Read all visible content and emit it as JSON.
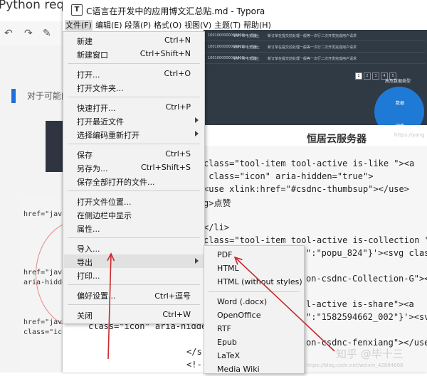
{
  "background": {
    "top_text": "Python requests + tkcsDNkif | 操作bar",
    "cut_text": "对于可能的",
    "code_lines": [
      "href=\"javas",
      "href=\"javas",
      "aria-hidde",
      "href=\"javas",
      "class=\"icon"
    ]
  },
  "window": {
    "app_icon": "T",
    "title": "C语言在开发中的应用博文汇总贴.md - Typora"
  },
  "menubar": [
    {
      "label": "文件(F)",
      "active": true
    },
    {
      "label": "编辑(E)",
      "active": false
    },
    {
      "label": "段落(P)",
      "active": false
    },
    {
      "label": "格式(O)",
      "active": false
    },
    {
      "label": "视图(V)",
      "active": false
    },
    {
      "label": "主题(T)",
      "active": false
    },
    {
      "label": "帮助(H)",
      "active": false
    }
  ],
  "file_menu": {
    "items": [
      {
        "label": "新建",
        "shortcut": "Ctrl+N"
      },
      {
        "label": "新建窗口",
        "shortcut": "Ctrl+Shift+N"
      },
      {
        "separator": true
      },
      {
        "label": "打开...",
        "shortcut": "Ctrl+O"
      },
      {
        "label": "打开文件夹...",
        "shortcut": ""
      },
      {
        "separator": true
      },
      {
        "label": "快速打开...",
        "shortcut": "Ctrl+P"
      },
      {
        "label": "打开最近文件",
        "shortcut": "",
        "submenu": true
      },
      {
        "label": "选择编码重新打开",
        "shortcut": "",
        "submenu": true
      },
      {
        "separator": true
      },
      {
        "label": "保存",
        "shortcut": "Ctrl+S"
      },
      {
        "label": "另存为...",
        "shortcut": "Ctrl+Shift+S"
      },
      {
        "label": "保存全部打开的文件...",
        "shortcut": ""
      },
      {
        "separator": true
      },
      {
        "label": "打开文件位置...",
        "shortcut": ""
      },
      {
        "label": "在侧边栏中显示",
        "shortcut": ""
      },
      {
        "label": "属性...",
        "shortcut": ""
      },
      {
        "separator": true
      },
      {
        "label": "导入...",
        "shortcut": ""
      },
      {
        "label": "导出",
        "shortcut": "",
        "submenu": true,
        "highlighted": true
      },
      {
        "label": "打印...",
        "shortcut": ""
      },
      {
        "separator": true
      },
      {
        "label": "偏好设置...",
        "shortcut": "Ctrl+逗号"
      },
      {
        "separator": true
      },
      {
        "label": "关闭",
        "shortcut": "Ctrl+W"
      }
    ]
  },
  "export_menu": {
    "items": [
      {
        "label": "PDF"
      },
      {
        "label": "HTML"
      },
      {
        "label": "HTML (without styles)"
      },
      {
        "separator": true
      },
      {
        "label": "Word (.docx)"
      },
      {
        "label": "OpenOffice"
      },
      {
        "label": "RTF"
      },
      {
        "label": "Epub"
      },
      {
        "label": "LaTeX"
      },
      {
        "label": "Media Wiki"
      }
    ]
  },
  "preview": {
    "rows": [
      {
        "id": "1001000000000001",
        "name": "WiFi 带电无线上",
        "status": "同步",
        "detail": "新订单在提交前处理一般等一次行二次开发完成用户请求"
      },
      {
        "id": "1001000000000002",
        "name": "WiFi 带电无线上",
        "status": "同步",
        "detail": "新订单在提交前处理一般等一次行二次开发完成用户请求"
      },
      {
        "id": "1001000000000003",
        "name": "WiFi 带电无线上",
        "status": "同步",
        "detail": "新订单在提交前处理一般等一次行二次开发完成用户请求"
      }
    ],
    "pages": [
      "1",
      "2",
      "3",
      "4",
      "5"
    ],
    "chart_title": "高危数据类型",
    "pie_label_a": "数据",
    "pie_label_b": "同步"
  },
  "caption": "恒居云服务器",
  "watermark_small": "https://yang",
  "code_lines": [
    "class=\"tool-item tool-active is-like \"><a",
    " class=\"icon\" aria-hidden=\"true\">",
    "<use xlink:href=\"#csdnc-thumbsup\"></use>",
    "g>点赞",
    "",
    "</li>",
    "class=\"tool-item tool-active is-collection \">",
    "\":\"popu_824\"}'><svg class",
    "",
    "on-csdnc-Collection-G\"></",
    "",
    "l-active is-share\"><a",
    "\":\"1582594662_002\"}'><svg",
    "",
    "on-csdnc-fenxiang\"></use>",
    "</svg>"
  ],
  "code_partial": {
    "line_a": "class=\"icon\" aria-hidden",
    "line_b": "</s",
    "line_c": "<!--"
  },
  "annotation": {
    "arrow_color": "#c8282d",
    "brand": "知乎 @毕十三",
    "url": "https://blog.csdn.net/weixin_42884668"
  }
}
